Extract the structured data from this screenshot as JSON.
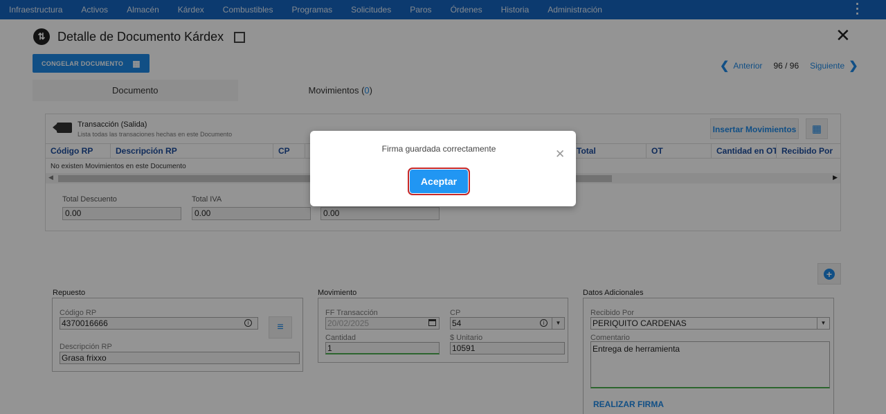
{
  "nav": {
    "items": [
      "Infraestructura",
      "Activos",
      "Almacén",
      "Kárdex",
      "Combustibles",
      "Programas",
      "Solicitudes",
      "Paros",
      "Órdenes",
      "Historia",
      "Administración"
    ]
  },
  "header": {
    "title": "Detalle de Documento Kárdex",
    "freeze_button": "CONGELAR DOCUMENTO"
  },
  "pager": {
    "prev": "Anterior",
    "count": "96 / 96",
    "next": "Siguiente"
  },
  "tabs": {
    "documento": "Documento",
    "movimientos_label": "Movimientos (",
    "movimientos_count": "0",
    "movimientos_close": ")"
  },
  "transaction": {
    "title": "Transacción (Salida)",
    "subtitle": "Lista todas las transaciones hechas en este Documento",
    "insert_button": "Insertar Movimientos",
    "columns": [
      "Código RP",
      "Descripción RP",
      "CP",
      "",
      "Total",
      "OT",
      "Cantidad en OT",
      "Recibido Por"
    ],
    "empty_message": "No existen Movimientos en este Documento"
  },
  "totals": {
    "descuento_label": "Total Descuento",
    "descuento_value": "0.00",
    "iva_label": "Total IVA",
    "iva_value": "0.00",
    "third_value": "0.00"
  },
  "repuesto": {
    "section": "Repuesto",
    "codigo_label": "Código RP",
    "codigo_value": "4370016666",
    "descripcion_label": "Descripción RP",
    "descripcion_value": "Grasa frixxo"
  },
  "movimiento": {
    "section": "Movimiento",
    "fecha_label": "FF Transacción",
    "fecha_value": "20/02/2025",
    "cp_label": "CP",
    "cp_value": "54",
    "cantidad_label": "Cantidad",
    "cantidad_value": "1",
    "unitario_label": "$ Unitario",
    "unitario_value": "10591"
  },
  "adicionales": {
    "section": "Datos Adicionales",
    "recibido_label": "Recibido Por",
    "recibido_value": "PERIQUITO CARDENAS",
    "comentario_label": "Comentario",
    "comentario_value": "Entrega de herramienta",
    "firma_link": "REALIZAR FIRMA"
  },
  "modal": {
    "message": "Firma guardada correctamente",
    "accept": "Aceptar"
  }
}
